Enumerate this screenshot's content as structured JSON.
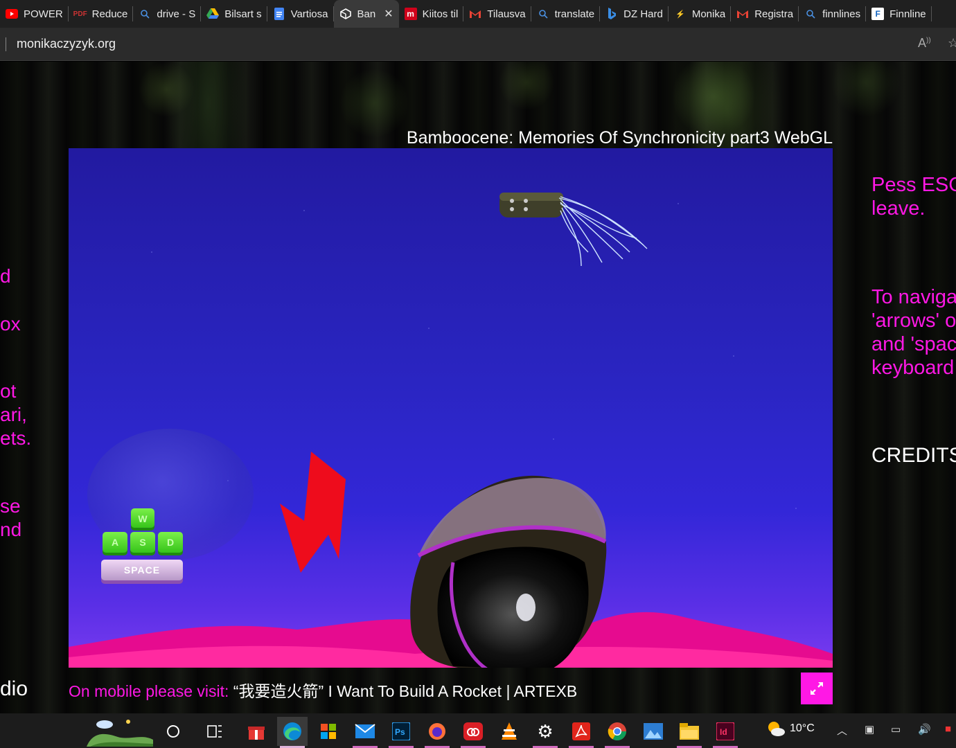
{
  "tabs": [
    {
      "label": "POWER",
      "icon": "youtube-icon",
      "color": "#ff0000"
    },
    {
      "label": "Reduce",
      "icon": "pdf-icon",
      "color": "#cc3333"
    },
    {
      "label": "drive - S",
      "icon": "search-icon",
      "color": "#4a90e2"
    },
    {
      "label": "Bilsart s",
      "icon": "google-drive-icon",
      "color": "#fbbc04"
    },
    {
      "label": "Vartiosa",
      "icon": "google-docs-icon",
      "color": "#4285f4"
    },
    {
      "label": "Ban",
      "icon": "unity-icon",
      "color": "#ffffff",
      "active": true
    },
    {
      "label": "Kiitos til",
      "icon": "m-logo-icon",
      "color": "#d0021b"
    },
    {
      "label": "Tilausva",
      "icon": "gmail-icon",
      "color": "#ea4335"
    },
    {
      "label": "translate",
      "icon": "search-icon",
      "color": "#4a90e2"
    },
    {
      "label": "DZ Hard",
      "icon": "bing-icon",
      "color": "#3a8ee6"
    },
    {
      "label": "Monika",
      "icon": "bolt-icon",
      "color": "#888888"
    },
    {
      "label": "Registra",
      "icon": "gmail-icon",
      "color": "#ea4335"
    },
    {
      "label": "finnlines",
      "icon": "search-icon",
      "color": "#4a90e2"
    },
    {
      "label": "Finnline",
      "icon": "finnlines-icon",
      "color": "#1565c0"
    }
  ],
  "address": {
    "url": "monikaczyzyk.org"
  },
  "page": {
    "webgl_title": "Bamboocene: Memories Of Synchronicity part3 WebGL",
    "left_fragments": [
      "d",
      "ox",
      "ot\nari,\nets.",
      "se\nnd"
    ],
    "left_studio": "dio",
    "right_instructions": [
      "Pess ESC\nleave.",
      "To naviga\n'arrows' o\nand 'spac\nkeyboard"
    ],
    "credits": "CREDITS",
    "mobile_prefix": "On mobile please visit:",
    "mobile_link": "“我要造火箭” I Want To Build A Rocket | ARTEXB",
    "keys": [
      "W",
      "A",
      "S",
      "D",
      "SPACE"
    ]
  },
  "taskbar": {
    "weather_temp": "10°C",
    "apps": [
      "cortana-icon",
      "task-view-icon",
      "gift-icon",
      "edge-icon",
      "store-icon",
      "mail-icon",
      "photoshop-icon",
      "firefox-icon",
      "creative-cloud-icon",
      "vlc-icon",
      "settings-icon",
      "acrobat-icon",
      "chrome-icon",
      "photos-icon",
      "file-explorer-icon",
      "indesign-icon"
    ]
  },
  "colors": {
    "accent_pink": "#ff18e5",
    "canvas_blue": "#2a25c2",
    "taskbar_underline": "#d26cbf"
  }
}
